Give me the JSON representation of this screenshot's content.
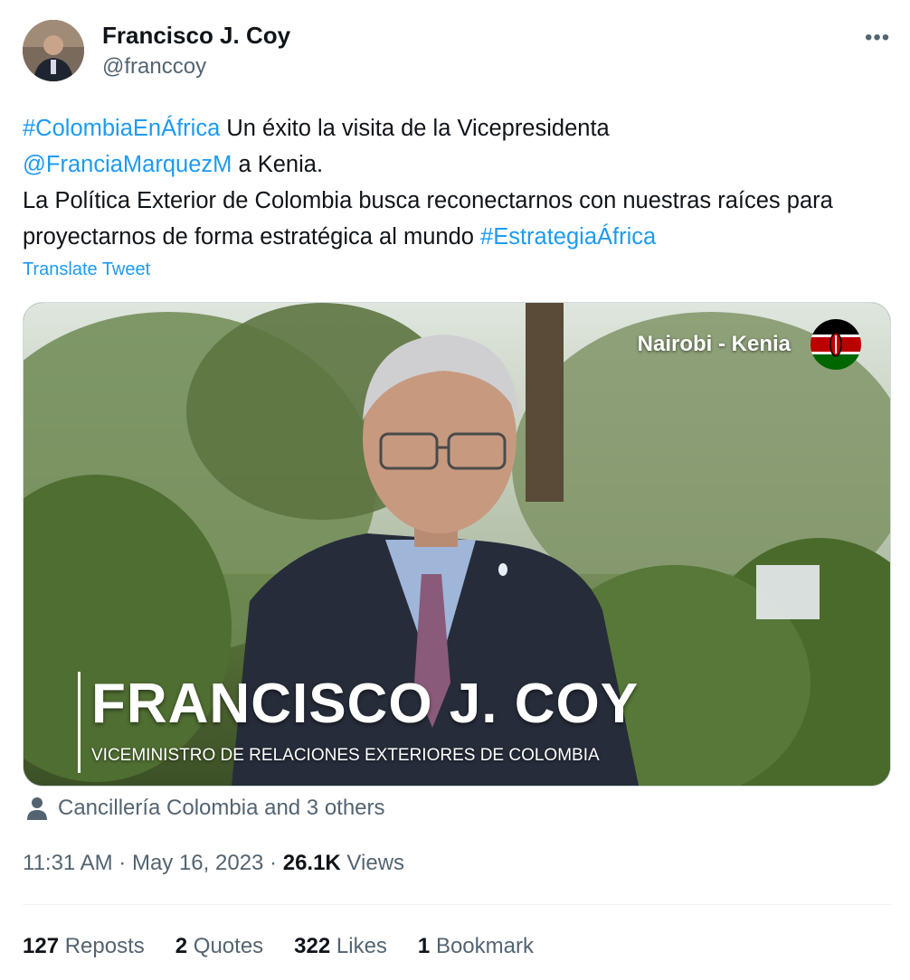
{
  "author": {
    "name": "Francisco J. Coy",
    "handle": "@franccoy",
    "avatar_icon": "avatar-photo"
  },
  "more_icon": "more-options-icon",
  "tweet": {
    "hashtag1": "#ColombiaEnÁfrica",
    "text1": " Un éxito la visita de la Vicepresidenta ",
    "mention": "@FranciaMarquezM",
    "text2": " a Kenia.",
    "text3": "La Política Exterior de Colombia busca reconectarnos con nuestras raíces para proyectarnos de forma estratégica al mundo ",
    "hashtag2": "#EstrategiaÁfrica"
  },
  "translate_label": "Translate Tweet",
  "media": {
    "location": "Nairobi - Kenia",
    "lower_third_name": "FRANCISCO J. COY",
    "lower_third_title": "VICEMINISTRO DE RELACIONES EXTERIORES DE COLOMBIA",
    "flag_icon": "kenya-flag-icon"
  },
  "tagged": "Cancillería Colombia and 3 others",
  "meta": {
    "time": "11:31 AM",
    "sep1": " · ",
    "date": "May 16, 2023",
    "sep2": " · ",
    "views_count": "26.1K",
    "views_label": " Views"
  },
  "stats": [
    {
      "count": "127",
      "label": " Reposts"
    },
    {
      "count": "2",
      "label": " Quotes"
    },
    {
      "count": "322",
      "label": " Likes"
    },
    {
      "count": "1",
      "label": " Bookmark"
    }
  ],
  "colors": {
    "link": "#1d9bf0",
    "secondary_text": "#536471",
    "primary_text": "#0f1419"
  }
}
